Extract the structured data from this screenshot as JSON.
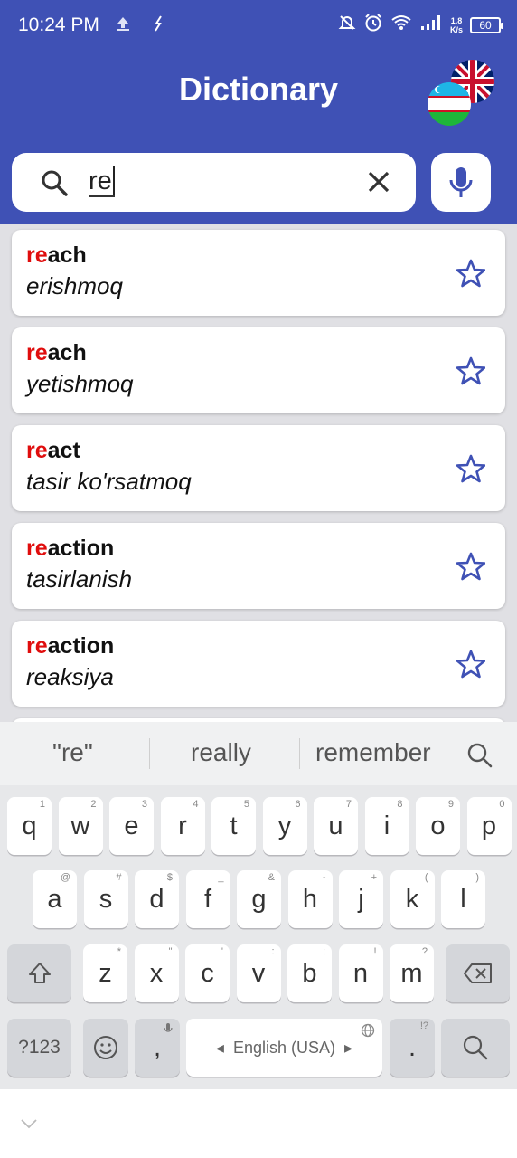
{
  "status": {
    "time": "10:24 PM",
    "net_top": "1.8",
    "net_bottom": "K/s",
    "battery": "60"
  },
  "header": {
    "title": "Dictionary"
  },
  "search": {
    "value": "re"
  },
  "results": [
    {
      "highlight": "re",
      "rest": "ach",
      "translation": "erishmoq"
    },
    {
      "highlight": "re",
      "rest": "ach",
      "translation": "yetishmoq"
    },
    {
      "highlight": "re",
      "rest": "act",
      "translation": "tasir ko'rsatmoq"
    },
    {
      "highlight": "re",
      "rest": "action",
      "translation": "tasirlanish"
    },
    {
      "highlight": "re",
      "rest": "action",
      "translation": "reaksiya"
    }
  ],
  "keyboard": {
    "suggestions": [
      "\"re\"",
      "really",
      "remember"
    ],
    "row1": [
      [
        "q",
        "1"
      ],
      [
        "w",
        "2"
      ],
      [
        "e",
        "3"
      ],
      [
        "r",
        "4"
      ],
      [
        "t",
        "5"
      ],
      [
        "y",
        "6"
      ],
      [
        "u",
        "7"
      ],
      [
        "i",
        "8"
      ],
      [
        "o",
        "9"
      ],
      [
        "p",
        "0"
      ]
    ],
    "row2": [
      [
        "a",
        "@"
      ],
      [
        "s",
        "#"
      ],
      [
        "d",
        "$"
      ],
      [
        "f",
        "_"
      ],
      [
        "g",
        "&"
      ],
      [
        "h",
        "-"
      ],
      [
        "j",
        "+"
      ],
      [
        "k",
        "("
      ],
      [
        "l",
        ")"
      ]
    ],
    "row3": [
      [
        "z",
        "*"
      ],
      [
        "x",
        "\""
      ],
      [
        "c",
        "'"
      ],
      [
        "v",
        ":"
      ],
      [
        "b",
        ";"
      ],
      [
        "n",
        "!"
      ],
      [
        "m",
        "?"
      ]
    ],
    "symbols_label": "?123",
    "comma": ",",
    "space_label": "English (USA)",
    "period": ".",
    "period_hint": "!?"
  },
  "colors": {
    "header": "#3f51b5",
    "highlight": "#e00d0d",
    "star": "#3f51b5"
  }
}
